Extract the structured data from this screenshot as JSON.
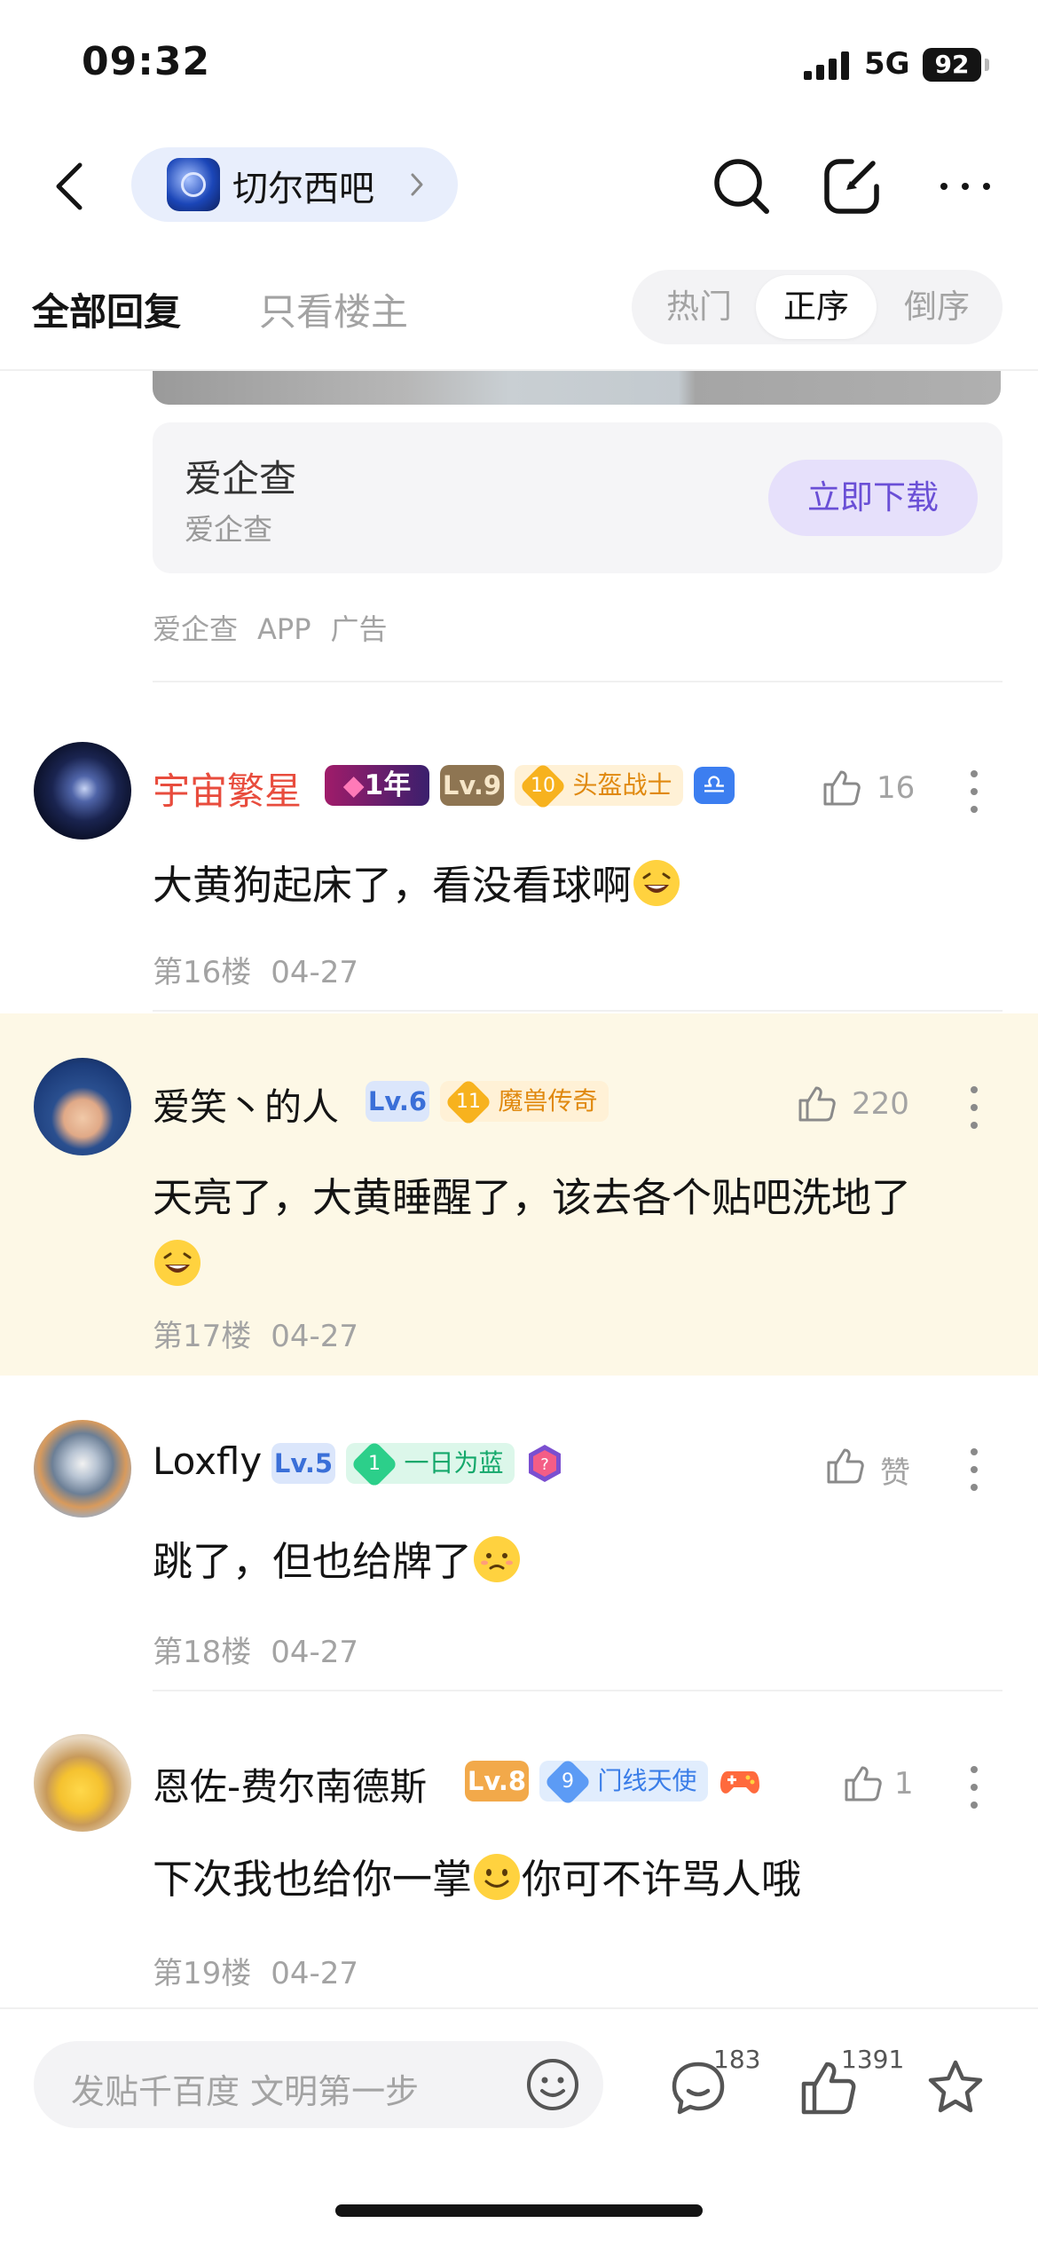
{
  "status_bar": {
    "time": "09:32",
    "network": "5G",
    "battery": "92"
  },
  "nav": {
    "forum_name": "切尔西吧",
    "icons": [
      "back-icon",
      "search-icon",
      "share-icon",
      "more-icon"
    ]
  },
  "tabs": {
    "all_replies": "全部回复",
    "owner_only": "只看楼主",
    "sort": [
      "热门",
      "正序",
      "倒序"
    ],
    "sort_selected": "正序"
  },
  "ad": {
    "title": "爱企查",
    "subtitle": "爱企查",
    "cta": "立即下载",
    "meta": [
      "爱企查",
      "APP",
      "广告"
    ]
  },
  "posts": [
    {
      "username": "宇宙繁星",
      "name_color": "#e84c3d",
      "badges": {
        "member": "1年",
        "level": "Lv.9",
        "title_num": "10",
        "title": "头盔战士"
      },
      "likes": "16",
      "content": "大黄狗起床了，看没看球啊",
      "floor": "第16楼",
      "date": "04-27"
    },
    {
      "username": "爱笑丶的人",
      "badges": {
        "level": "Lv.6",
        "title_num": "11",
        "title": "魔兽传奇"
      },
      "likes": "220",
      "content": "天亮了，大黄睡醒了，该去各个贴吧洗地了",
      "floor": "第17楼",
      "date": "04-27",
      "highlight_color": "#fdf8e6"
    },
    {
      "username": "Loxfly",
      "badges": {
        "level": "Lv.5",
        "title_num": "1",
        "title": "一日为蓝"
      },
      "likes": "赞",
      "content": "跳了，但也给牌了",
      "floor": "第18楼",
      "date": "04-27"
    },
    {
      "username": "恩佐-费尔南德斯",
      "badges": {
        "level": "Lv.8",
        "title_num": "9",
        "title": "门线天使"
      },
      "likes": "1",
      "content_before": "下次我也给你一掌",
      "content_after": "你可不许骂人哦",
      "floor": "第19楼",
      "date": "04-27"
    }
  ],
  "bottom_bar": {
    "placeholder": "发贴千百度 文明第一步",
    "comments": "183",
    "likes": "1391"
  },
  "colors": {
    "accent_purple": "#6a4fd6",
    "name_red": "#e84c3d",
    "meta_gray": "#a3a3a3"
  }
}
